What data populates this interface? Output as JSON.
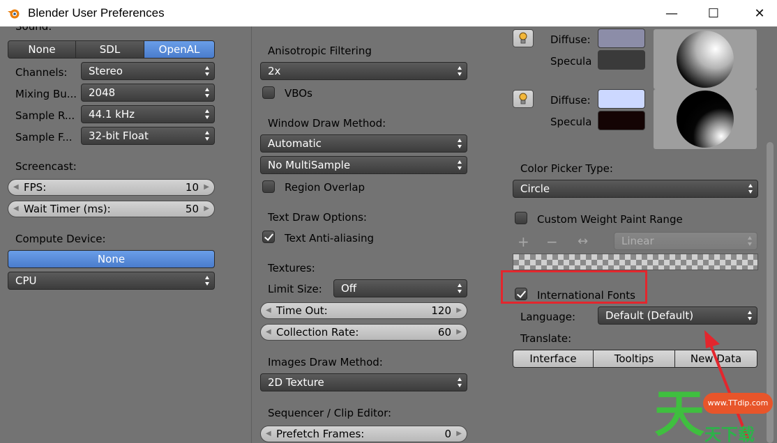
{
  "window": {
    "title": "Blender User Preferences",
    "minimize": "—",
    "maximize": "☐",
    "close": "✕"
  },
  "col1": {
    "sound_label": "Sound:",
    "sound_options": [
      "None",
      "SDL",
      "OpenAL"
    ],
    "sound_selected": "OpenAL",
    "channels": {
      "label": "Channels:",
      "value": "Stereo"
    },
    "mixing": {
      "label": "Mixing Bu...",
      "value": "2048"
    },
    "sample_rate": {
      "label": "Sample R...",
      "value": "44.1 kHz"
    },
    "sample_format": {
      "label": "Sample F...",
      "value": "32-bit Float"
    },
    "screencast_label": "Screencast:",
    "fps": {
      "label": "FPS:",
      "value": "10"
    },
    "wait_timer": {
      "label": "Wait Timer (ms):",
      "value": "50"
    },
    "compute_label": "Compute Device:",
    "compute_none": "None",
    "compute_device": "CPU"
  },
  "col2": {
    "aniso_label": "Anisotropic Filtering",
    "aniso_value": "2x",
    "vbos_label": "VBOs",
    "vbos_checked": false,
    "window_draw_label": "Window Draw Method:",
    "window_draw_value": "Automatic",
    "multisample_value": "No MultiSample",
    "region_overlap_label": "Region Overlap",
    "region_overlap_checked": false,
    "text_draw_label": "Text Draw Options:",
    "text_aa_label": "Text Anti-aliasing",
    "text_aa_checked": true,
    "textures_label": "Textures:",
    "limit_size_label": "Limit Size:",
    "limit_size_value": "Off",
    "time_out": {
      "label": "Time Out:",
      "value": "120"
    },
    "collection_rate": {
      "label": "Collection Rate:",
      "value": "60"
    },
    "images_draw_label": "Images Draw Method:",
    "images_draw_value": "2D Texture",
    "sequencer_label": "Sequencer / Clip Editor:",
    "prefetch": {
      "label": "Prefetch Frames:",
      "value": "0"
    }
  },
  "col3": {
    "light1": {
      "diffuse_label": "Diffuse:",
      "specular_label": "Specula",
      "diffuse_color": "#8c8da8",
      "specular_color": "#3a3a3a"
    },
    "light2": {
      "diffuse_label": "Diffuse:",
      "specular_label": "Specula",
      "diffuse_color": "#ccd8ff",
      "specular_color": "#140404"
    },
    "color_picker_label": "Color Picker Type:",
    "color_picker_value": "Circle",
    "custom_weight_label": "Custom Weight Paint Range",
    "custom_weight_checked": false,
    "ramp_plus": "+",
    "ramp_minus": "−",
    "ramp_flip": "↔",
    "ramp_interp": "Linear",
    "intl_fonts_label": "International Fonts",
    "intl_fonts_checked": true,
    "language_label": "Language:",
    "language_value": "Default (Default)",
    "translate_label": "Translate:",
    "translate_options": [
      "Interface",
      "Tooltips",
      "New Data"
    ]
  },
  "watermark": {
    "url": "www.TTdip.com",
    "big": "天",
    "small": "天下载"
  },
  "colors": {
    "panel_bg": "#737373",
    "accent_blue": "#5a8ed8",
    "highlight_red": "#e3262d"
  }
}
